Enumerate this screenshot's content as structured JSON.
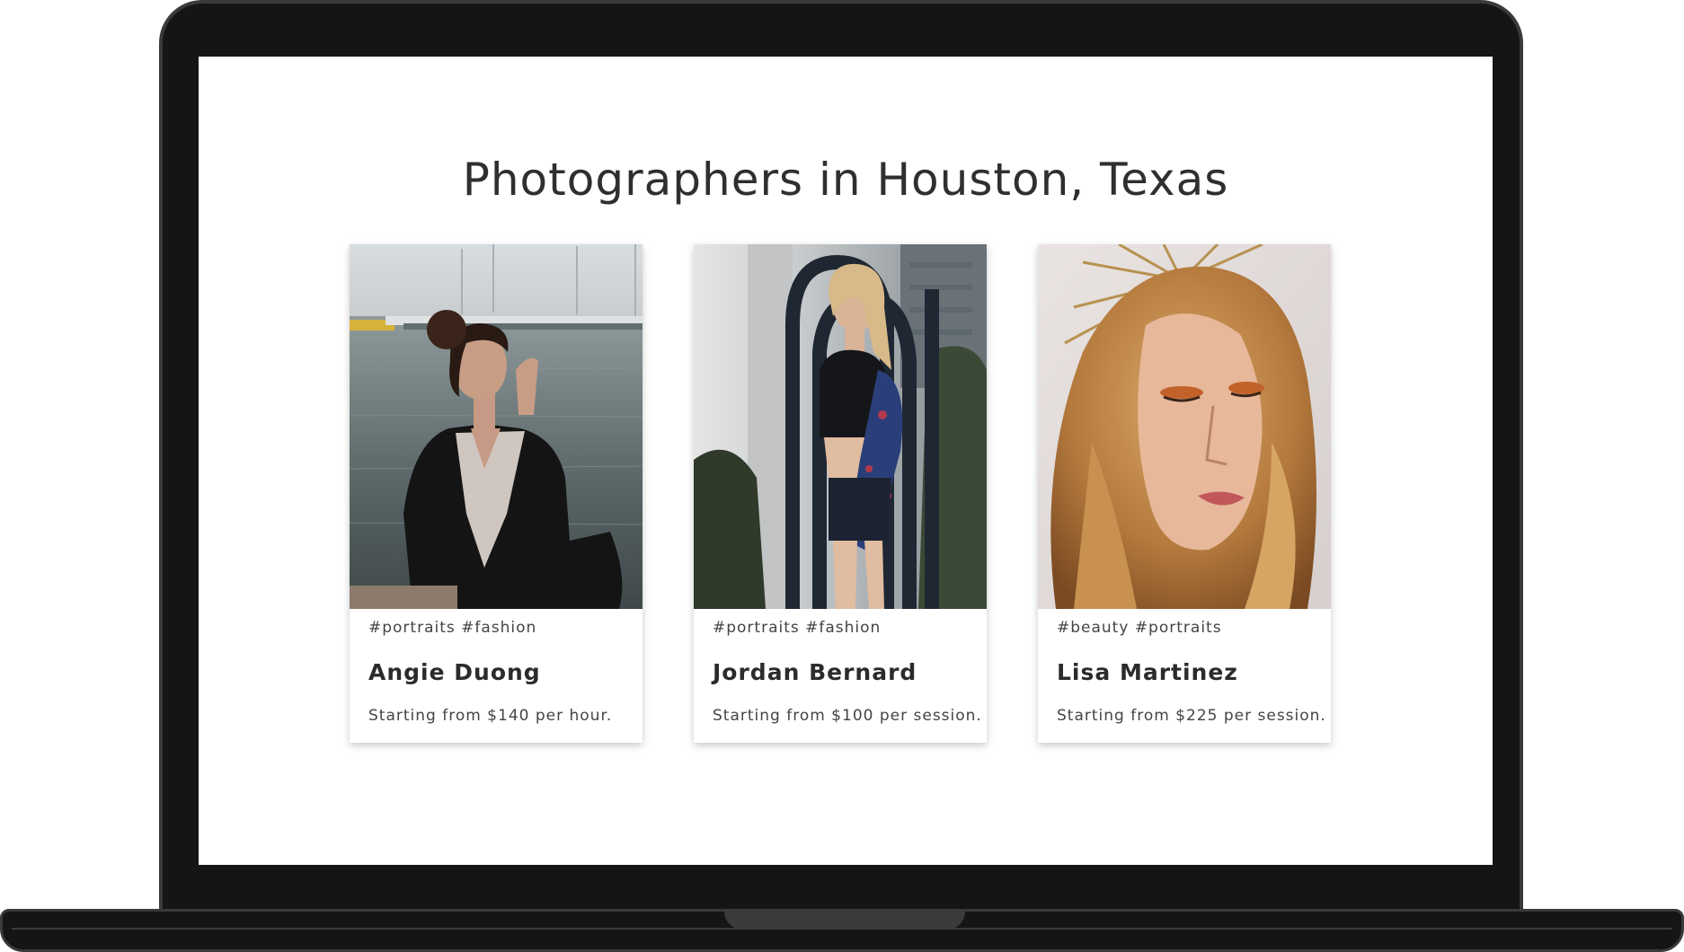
{
  "page": {
    "title": "Photographers in Houston, Texas"
  },
  "photographers": [
    {
      "tags": "#portraits #fashion",
      "name": "Angie Duong",
      "price": "Starting from $140 per hour."
    },
    {
      "tags": "#portraits #fashion",
      "name": "Jordan Bernard",
      "price": "Starting from $100 per session."
    },
    {
      "tags": "#beauty #portraits",
      "name": "Lisa Martinez",
      "price": "Starting from $225 per session."
    }
  ],
  "colors": {
    "frame": "#151515",
    "frame_edge": "#3a3a3a",
    "screen_background": "#ffffff",
    "title_text": "#2f2f2f",
    "body_text": "#444444"
  }
}
